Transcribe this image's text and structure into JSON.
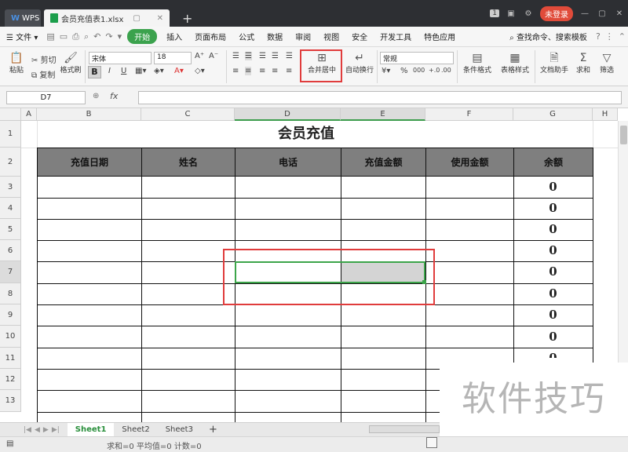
{
  "titlebar": {
    "app_tab": "WPS",
    "file_tab": "会员充值表1.xlsx",
    "login_label": "未登录",
    "page_badge": "1"
  },
  "menu": {
    "file_label": "文件",
    "items": [
      "开始",
      "插入",
      "页面布局",
      "公式",
      "数据",
      "审阅",
      "视图",
      "安全",
      "开发工具",
      "特色应用"
    ],
    "search_label": "查找命令、搜索模板"
  },
  "ribbon": {
    "paste": "粘贴",
    "cut": "剪切",
    "copy": "复制",
    "format_painter": "格式刷",
    "font_name": "宋体",
    "font_size": "18",
    "merge_center": "合并居中",
    "wrap_text": "自动换行",
    "number_format": "常规",
    "cond_format": "条件格式",
    "table_style": "表格样式",
    "doc_assistant": "文档助手",
    "sum": "求和",
    "filter": "筛选",
    "bold": "B",
    "italic": "I",
    "underline": "U",
    "percent": "%"
  },
  "formula": {
    "cell_ref": "D7",
    "fx": "fx"
  },
  "columns": [
    "A",
    "B",
    "C",
    "D",
    "E",
    "F",
    "G",
    "H"
  ],
  "rows": [
    "1",
    "2",
    "3",
    "4",
    "5",
    "6",
    "7",
    "8",
    "9",
    "10",
    "11",
    "12",
    "13"
  ],
  "sheet": {
    "title": "会员充值",
    "headers": [
      "充值日期",
      "姓名",
      "电话",
      "充值金额",
      "使用金额",
      "余额"
    ],
    "balance_values": [
      "0",
      "0",
      "0",
      "0",
      "0",
      "0",
      "0",
      "0",
      "0"
    ]
  },
  "tabs": [
    "Sheet1",
    "Sheet2",
    "Sheet3"
  ],
  "tab_add": "+",
  "status": {
    "text": "求和=0  平均值=0  计数=0"
  },
  "watermark": "软件技巧",
  "accent_color": "#3ba24d",
  "highlight_color": "#e03c3c"
}
